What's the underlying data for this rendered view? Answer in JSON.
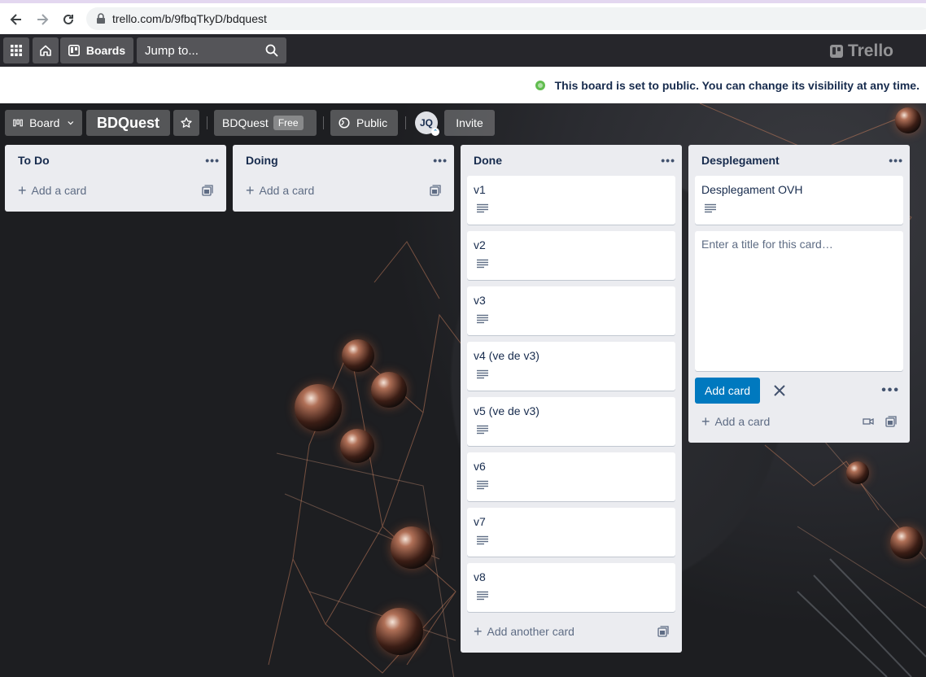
{
  "browser": {
    "url": "trello.com/b/9fbqTkyD/bdquest"
  },
  "header": {
    "boards_label": "Boards",
    "jump_placeholder": "Jump to...",
    "logo_text": "Trello"
  },
  "banner": {
    "text": "This board is set to public. You can change its visibility at any time."
  },
  "board_bar": {
    "view_label": "Board",
    "board_name": "BDQuest",
    "workspace_name": "BDQuest",
    "workspace_plan": "Free",
    "visibility_label": "Public",
    "avatar_initials": "JQ",
    "invite_label": "Invite"
  },
  "lists": [
    {
      "title": "To Do",
      "cards": [],
      "add_label": "Add a card"
    },
    {
      "title": "Doing",
      "cards": [],
      "add_label": "Add a card"
    },
    {
      "title": "Done",
      "cards": [
        "v1",
        "v2",
        "v3",
        "v4 (ve de v3)",
        "v5 (ve de v3)",
        "v6",
        "v7",
        "v8"
      ],
      "add_label": "Add another card"
    },
    {
      "title": "Desplegament",
      "cards": [
        "Desplegament OVH"
      ],
      "add_label": "Add a card"
    }
  ],
  "composer": {
    "placeholder": "Enter a title for this card…",
    "value": "",
    "submit_label": "Add card"
  },
  "colors": {
    "accent": "#0079bf",
    "list_bg": "#ebecf0",
    "public_globe": "#61bd4f"
  }
}
